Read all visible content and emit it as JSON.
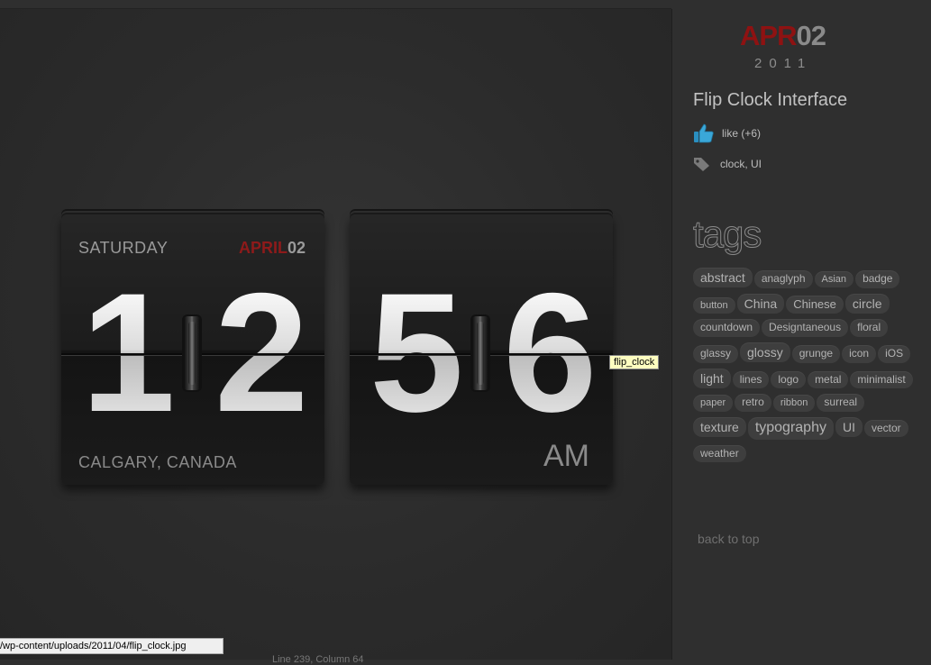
{
  "clock": {
    "weekday": "SATURDAY",
    "month": "APRIL",
    "day": "02",
    "hour_tens": "1",
    "hour_ones": "2",
    "minute_tens": "5",
    "minute_ones": "6",
    "location": "CALGARY, CANADA",
    "ampm": "AM"
  },
  "tooltip": "flip_clock",
  "status_url": "/wp-content/uploads/2011/04/flip_clock.jpg",
  "status_under": "Line 239, Column 64",
  "post": {
    "month": "APR",
    "day": "02",
    "year": "2011",
    "title": "Flip Clock Interface",
    "like_text": "like (+6)",
    "tags_text": "clock, UI"
  },
  "tags_heading": "tags",
  "tags": [
    {
      "label": "abstract",
      "size": 14
    },
    {
      "label": "anaglyph",
      "size": 12
    },
    {
      "label": "Asian",
      "size": 11
    },
    {
      "label": "badge",
      "size": 12
    },
    {
      "label": "button",
      "size": 11
    },
    {
      "label": "China",
      "size": 14
    },
    {
      "label": "Chinese",
      "size": 13
    },
    {
      "label": "circle",
      "size": 14
    },
    {
      "label": "countdown",
      "size": 12
    },
    {
      "label": "Designtaneous",
      "size": 12
    },
    {
      "label": "floral",
      "size": 12
    },
    {
      "label": "glassy",
      "size": 12
    },
    {
      "label": "glossy",
      "size": 14
    },
    {
      "label": "grunge",
      "size": 12
    },
    {
      "label": "icon",
      "size": 12
    },
    {
      "label": "iOS",
      "size": 12
    },
    {
      "label": "light",
      "size": 14
    },
    {
      "label": "lines",
      "size": 12
    },
    {
      "label": "logo",
      "size": 12
    },
    {
      "label": "metal",
      "size": 12
    },
    {
      "label": "minimalist",
      "size": 12
    },
    {
      "label": "paper",
      "size": 11
    },
    {
      "label": "retro",
      "size": 12
    },
    {
      "label": "ribbon",
      "size": 11
    },
    {
      "label": "surreal",
      "size": 12
    },
    {
      "label": "texture",
      "size": 14
    },
    {
      "label": "typography",
      "size": 16
    },
    {
      "label": "UI",
      "size": 14
    },
    {
      "label": "vector",
      "size": 12
    },
    {
      "label": "weather",
      "size": 12
    }
  ],
  "back_to_top": "back to top",
  "colors": {
    "accent_red": "#8e1212",
    "background": "#2f2f2f",
    "tag_bg": "#3e3e3e"
  }
}
